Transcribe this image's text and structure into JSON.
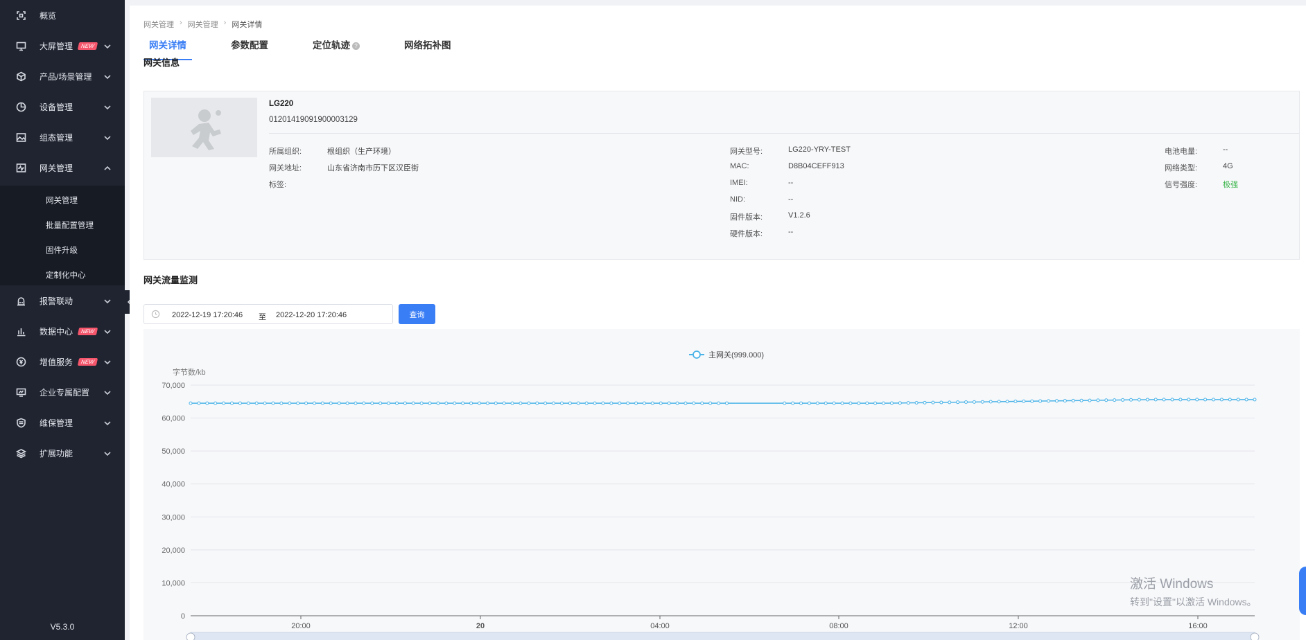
{
  "sidebar": {
    "items": [
      {
        "label": "概览",
        "icon": "overview-icon",
        "badge": "",
        "chevron": ""
      },
      {
        "label": "大屏管理",
        "icon": "screen-icon",
        "badge": "NEW",
        "chevron": "down"
      },
      {
        "label": "产品/场景管理",
        "icon": "cube-icon",
        "badge": "",
        "chevron": "down"
      },
      {
        "label": "设备管理",
        "icon": "pie-chart-icon",
        "badge": "",
        "chevron": "down"
      },
      {
        "label": "组态管理",
        "icon": "image-icon",
        "badge": "",
        "chevron": "down"
      },
      {
        "label": "网关管理",
        "icon": "pulse-icon",
        "badge": "",
        "chevron": "up"
      },
      {
        "label": "报警联动",
        "icon": "alarm-icon",
        "badge": "",
        "chevron": "down"
      },
      {
        "label": "数据中心",
        "icon": "bar-chart-icon",
        "badge": "NEW",
        "chevron": "down"
      },
      {
        "label": "增值服务",
        "icon": "dollar-icon",
        "badge": "NEW",
        "chevron": "down"
      },
      {
        "label": "企业专属配置",
        "icon": "monitor-icon",
        "badge": "",
        "chevron": "down"
      },
      {
        "label": "维保管理",
        "icon": "shield-icon",
        "badge": "",
        "chevron": "down"
      },
      {
        "label": "扩展功能",
        "icon": "layers-icon",
        "badge": "",
        "chevron": "down"
      }
    ],
    "submenu": [
      "网关管理",
      "批量配置管理",
      "固件升级",
      "定制化中心"
    ],
    "version": "V5.3.0"
  },
  "breadcrumb": [
    "网关管理",
    "网关管理",
    "网关详情"
  ],
  "tabs": [
    "网关详情",
    "参数配置",
    "定位轨迹",
    "网络拓补图"
  ],
  "tab_help": "?",
  "sections": {
    "info_title": "网关信息",
    "traffic_title": "网关流量监测"
  },
  "device": {
    "name": "LG220",
    "sn": "01201419091900003129",
    "col1": [
      {
        "k": "所属组织:",
        "v": "根组织（生产环境）"
      },
      {
        "k": "网关地址:",
        "v": "山东省济南市历下区汉臣街"
      },
      {
        "k": "标签:",
        "v": ""
      }
    ],
    "col2": [
      {
        "k": "网关型号:",
        "v": "LG220-YRY-TEST"
      },
      {
        "k": "MAC:",
        "v": "D8B04CEFF913"
      },
      {
        "k": "IMEI:",
        "v": "--"
      },
      {
        "k": "NID:",
        "v": "--"
      },
      {
        "k": "固件版本:",
        "v": "V1.2.6"
      },
      {
        "k": "硬件版本:",
        "v": "--"
      }
    ],
    "col3": [
      {
        "k": "电池电量:",
        "v": "--"
      },
      {
        "k": "网络类型:",
        "v": "4G"
      },
      {
        "k": "信号强度:",
        "v": "极强"
      }
    ],
    "signal_color": "#39b54a"
  },
  "query": {
    "start": "2022-12-19 17:20:46",
    "to": "至",
    "end": "2022-12-20 17:20:46",
    "button": "查询"
  },
  "chart_data": {
    "type": "line",
    "ylabel": "字节数/kb",
    "ylim": [
      0,
      70000
    ],
    "yticks": [
      "0",
      "10,000",
      "20,000",
      "30,000",
      "40,000",
      "50,000",
      "60,000",
      "70,000"
    ],
    "xticks": [
      "20:00",
      "20",
      "04:00",
      "08:00",
      "12:00",
      "16:00"
    ],
    "series": [
      {
        "name": "主网关(999.000)",
        "color": "#4ab3e8",
        "start_value": 64500,
        "end_value": 65600,
        "point_count": 130,
        "gap_after_index": 65
      }
    ],
    "legend": "top-center",
    "grid": true
  },
  "watermark": {
    "line1": "激活 Windows",
    "line2": "转到\"设置\"以激活 Windows。"
  },
  "colors": {
    "accent": "#3a7ef5",
    "sidebar_bg": "#1f2430",
    "badge": "#f5566c"
  }
}
